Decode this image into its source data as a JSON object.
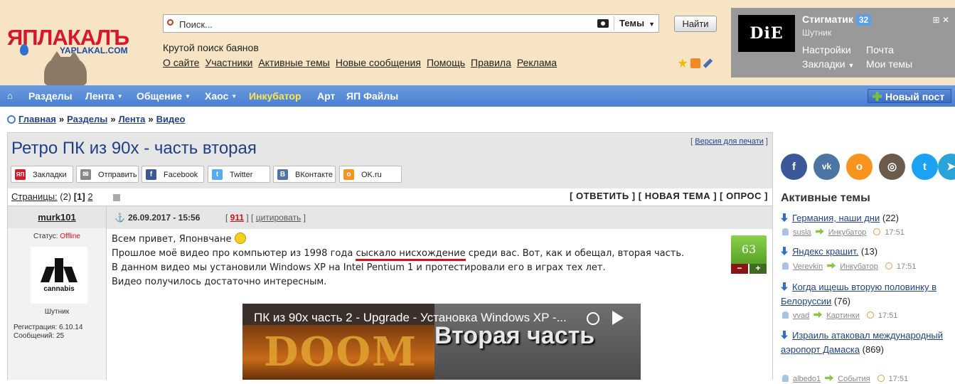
{
  "header": {
    "logo_text": "ЯПЛАКАЛЪ",
    "logo_url": "YAPLAKAL.COM",
    "search": {
      "placeholder": "Поиск...",
      "scope": "Темы",
      "button": "Найти"
    },
    "slogan": "Крутой поиск баянов",
    "links": [
      "О сайте",
      "Участники",
      "Активные темы",
      "Новые сообщения",
      "Помощь",
      "Правила",
      "Реклама"
    ]
  },
  "user": {
    "avatar_text": "DiE",
    "name": "Стигматик",
    "badge": "32",
    "rank": "Шутник",
    "settings": "Настройки",
    "mail": "Почта",
    "bookmarks": "Закладки",
    "my_topics": "Мои темы"
  },
  "nav": {
    "items": [
      "Разделы",
      "Лента",
      "Общение",
      "Хаос",
      "Инкубатор",
      "Арт",
      "ЯП Файлы"
    ],
    "new_post": "Новый пост"
  },
  "breadcrumb": [
    "Главная",
    "Разделы",
    "Лента",
    "Видео"
  ],
  "topic": {
    "title": "Ретро ПК из 90х - часть вторая",
    "print_version": "Версия для печати",
    "share": [
      "Закладки",
      "Отправить",
      "Facebook",
      "Twitter",
      "ВКонтакте",
      "OK.ru"
    ],
    "pages_label": "Страницы:",
    "pages_count": "(2)",
    "page_current": "[1]",
    "page_next": "2",
    "actions": "[ ОТВЕТИТЬ ] [ НОВАЯ ТЕМА ] [ ОПРОС ]"
  },
  "post": {
    "author": "murk101",
    "date": "26.09.2017 - 15:56",
    "number": "911",
    "quote": "цитировать",
    "status_label": "Статус:",
    "status_value": "Offline",
    "avatar_text": "cannabis",
    "rank": "Шутник",
    "reg": "Регистрация: 6.10.14",
    "msgs": "Сообщений: 25",
    "line1": "Всем привет, Японвчане",
    "line2_a": "Прошлое моё видео про компьютер из 1998 года ",
    "line2_b": "сыскало нисхождение",
    "line2_c": " среди вас. Вот, как и обещал, вторая часть.",
    "line3": "В данном видео мы установили Windows XP на Intel Pentium 1 и протестировали его в играх тех лет.",
    "line4": "Видео получилось достаточно интересным.",
    "rating": "63",
    "video_title": "ПК из 90х часть 2 - Upgrade - Установка Windows XP -...",
    "video_overlay": "Вторая часть",
    "video_doom": "DOOM"
  },
  "sidebar": {
    "social": [
      "f",
      "vk",
      "ok",
      "ig",
      "tw",
      "tg"
    ],
    "title": "Активные темы",
    "topics": [
      {
        "title": "Германия, наши дни",
        "count": "(22)",
        "author": "susla",
        "forum": "Инкубатор",
        "time": "17:51"
      },
      {
        "title": "Яндекс крашит.",
        "count": "(13)",
        "author": "Verevkin",
        "forum": "Инкубатор",
        "time": "17:51"
      },
      {
        "title": "Когда ищешь вторую половинку в Белоруссии",
        "count": "(76)",
        "author": "vvad",
        "forum": "Картинки",
        "time": "17:51"
      },
      {
        "title": "Израиль атаковал международный аэропорт Дамаска",
        "count": "(869)",
        "author": "albedo1",
        "forum": "События",
        "time": "17:51"
      }
    ]
  },
  "colors": {
    "brand_red": "#d5182a",
    "nav_blue": "#4a7fd0",
    "link": "#24428a",
    "rating_green": "#57a326",
    "header_bg": "#f7e4c4"
  }
}
